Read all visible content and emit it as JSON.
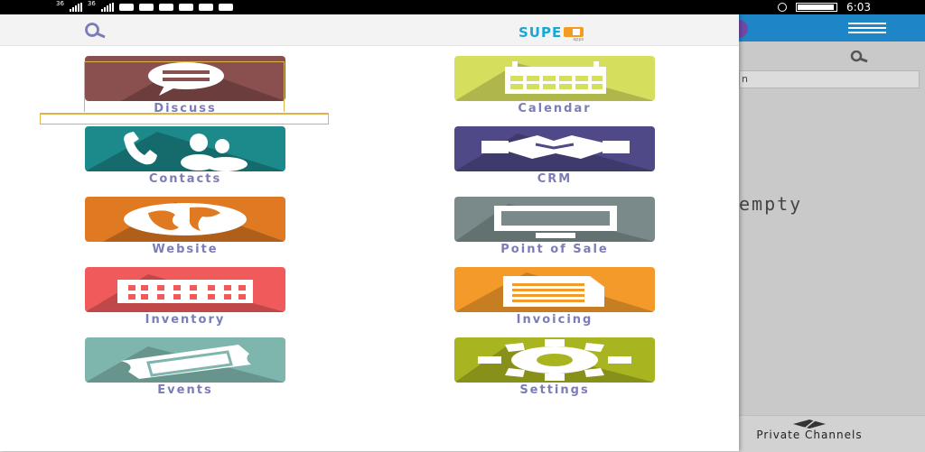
{
  "status_bar": {
    "sig1": "36",
    "sig2": "36",
    "time": "6:03"
  },
  "drawer": {
    "search_icon": "search-icon",
    "logo": {
      "text": "SUPE",
      "sub": "apps"
    },
    "apps": [
      {
        "label": "Discuss",
        "icon": "chat-bubble-icon",
        "color": "#8a4f4f"
      },
      {
        "label": "Calendar",
        "icon": "calendar-icon",
        "color": "#d6df5d"
      },
      {
        "label": "Contacts",
        "icon": "contacts-icon",
        "color": "#1c8a8a"
      },
      {
        "label": "CRM",
        "icon": "handshake-icon",
        "color": "#4f4988"
      },
      {
        "label": "Website",
        "icon": "globe-icon",
        "color": "#e07a22"
      },
      {
        "label": "Point of Sale",
        "icon": "monitor-icon",
        "color": "#7a8a8a"
      },
      {
        "label": "Inventory",
        "icon": "warehouse-icon",
        "color": "#f05a5a"
      },
      {
        "label": "Invoicing",
        "icon": "invoice-icon",
        "color": "#f39a2a"
      },
      {
        "label": "Events",
        "icon": "ticket-icon",
        "color": "#7eb5ad"
      },
      {
        "label": "Settings",
        "icon": "gear-icon",
        "color": "#a9b520"
      }
    ]
  },
  "background_app": {
    "input_text": "n",
    "empty_text": "empty",
    "bottom_tab_label": "Private Channels"
  }
}
